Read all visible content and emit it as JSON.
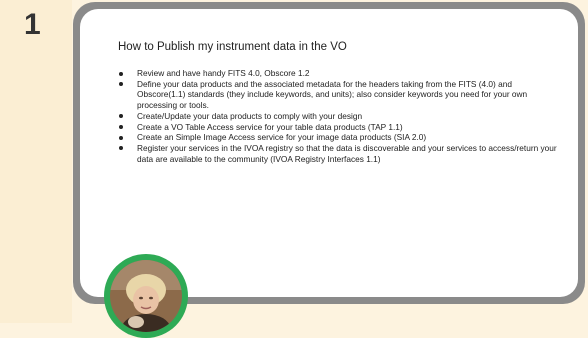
{
  "slide": {
    "number": "1"
  },
  "card": {
    "title": "How to Publish my instrument data in the VO",
    "bullets": [
      "Review and have handy FITS 4.0, Obscore 1.2",
      "Define your data products and the associated metadata for the headers taking from the FITS (4.0) and Obscore(1.1) standards (they  include keywords, and units); also consider keywords you need for your own processing or tools.",
      "Create/Update your data products to comply with your design",
      "Create a VO Table Access service for your table data products (TAP 1.1)",
      "Create an Simple Image Access service for your image data products (SIA 2.0)",
      "Register your services in the IVOA registry so that the data is discoverable and your services to access/return your data are available to the community (IVOA Registry Interfaces 1.1)"
    ]
  },
  "avatar": {
    "ring_color": "#2eaa55",
    "icon": "user-photo"
  },
  "colors": {
    "page_background": "#fdf3df",
    "card_border": "#8a8a8a",
    "card_background": "#ffffff"
  }
}
